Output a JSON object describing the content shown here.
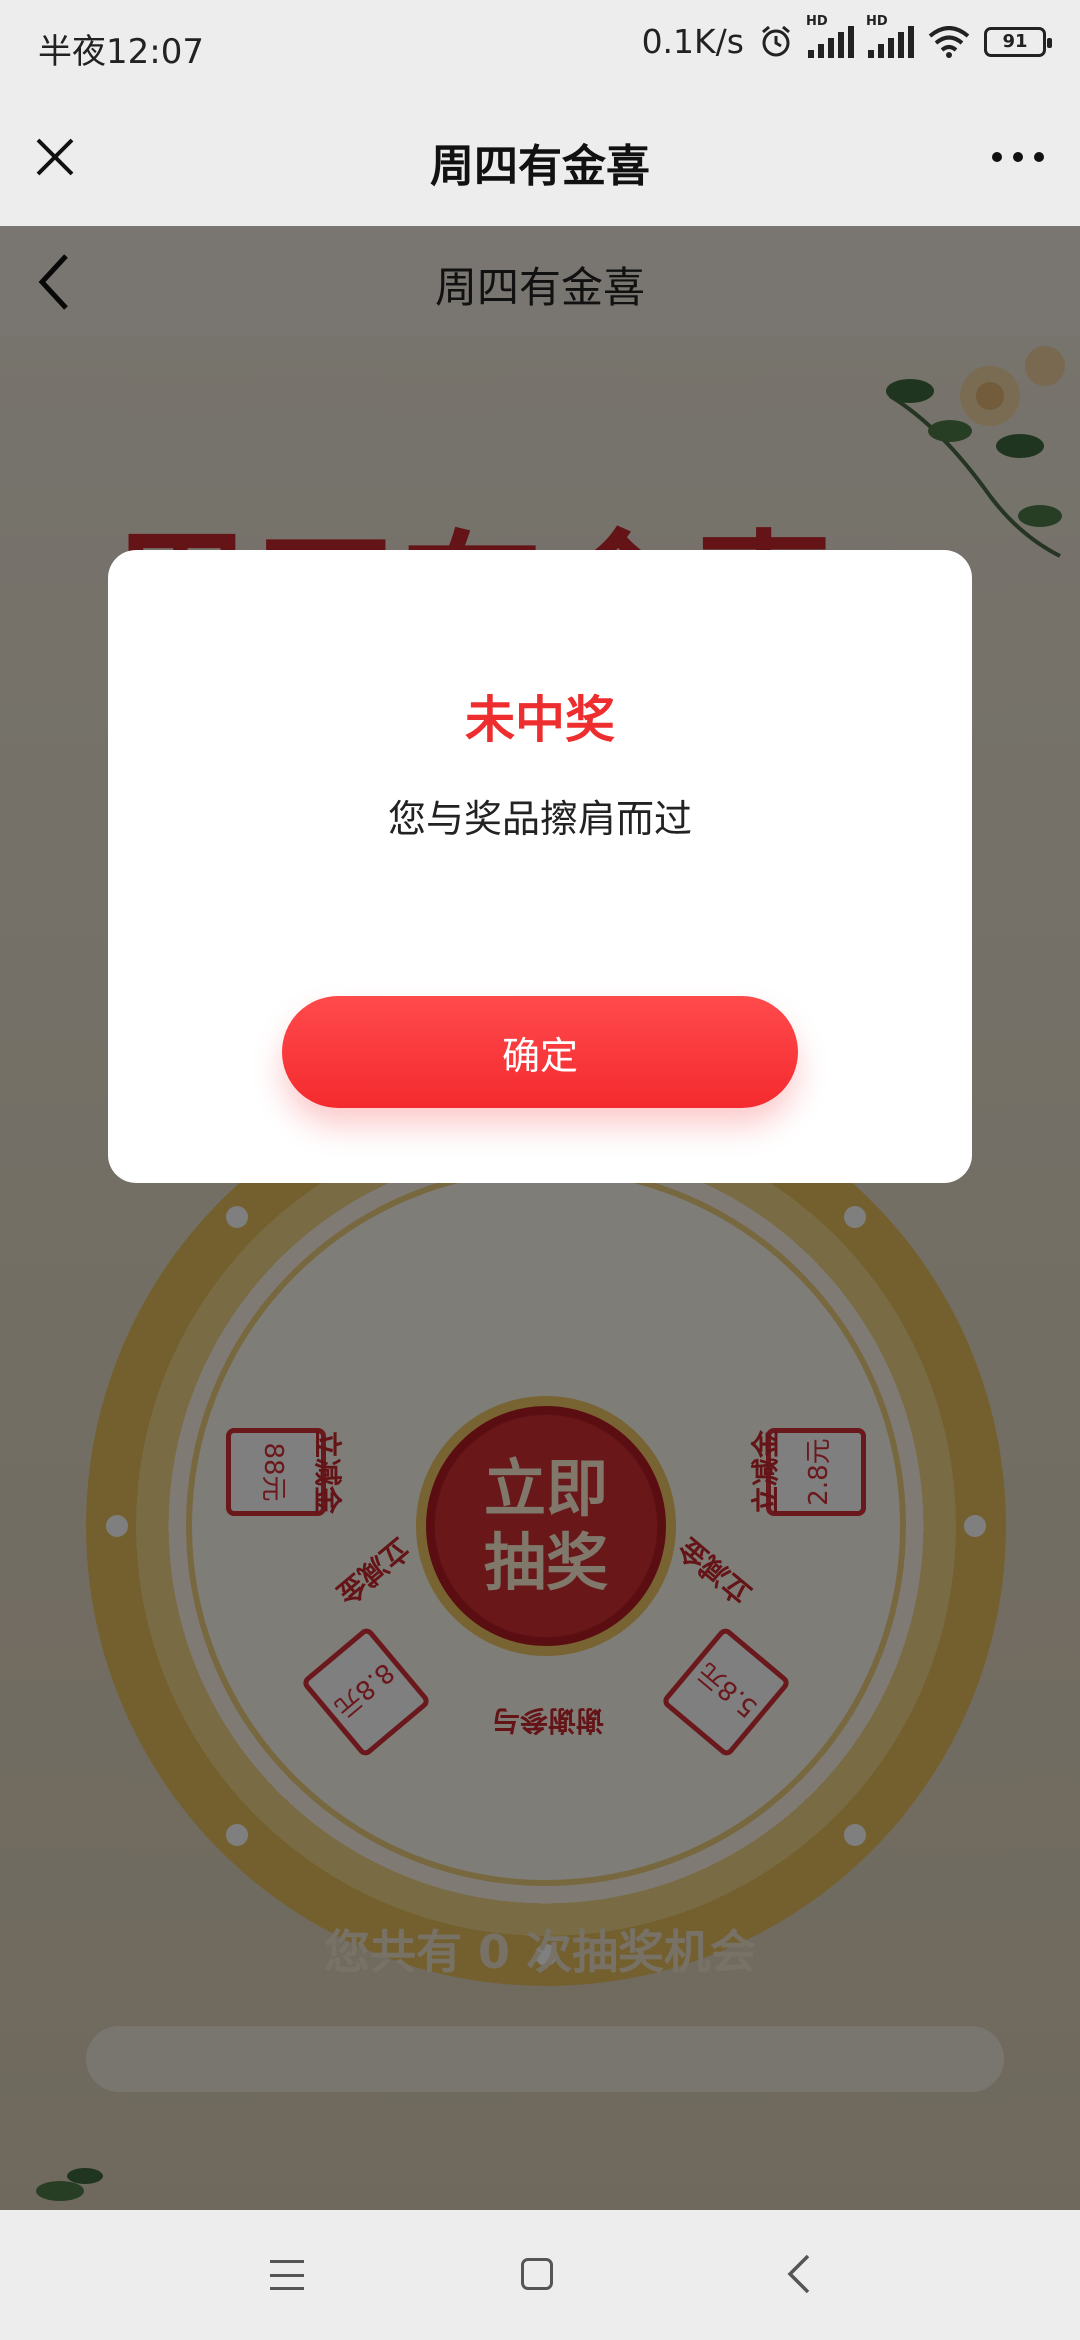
{
  "status_bar": {
    "time": "半夜12:07",
    "network_speed": "0.1K/s",
    "battery": "91",
    "hd1": "HD",
    "hd2": "HD"
  },
  "app_bar": {
    "title": "周四有金喜",
    "close_icon": "close-icon",
    "more_icon": "more-dots-icon"
  },
  "page": {
    "header_title": "周四有金喜",
    "big_title": "周四有金喜",
    "wheel": {
      "hub_line1": "立即",
      "hub_line2": "抽奖",
      "segments": [
        "立减金",
        "立减金",
        "谢谢参与",
        "立减金",
        "立减金"
      ],
      "coupons": [
        "88元",
        "2.8元",
        "8.8元",
        "5.8元"
      ]
    },
    "chances_text": "您共有 0 次抽奖机会"
  },
  "modal": {
    "title": "未中奖",
    "message": "您与奖品擦肩而过",
    "confirm_label": "确定"
  },
  "nav_bar": {
    "menu_icon": "menu-icon",
    "home_icon": "home-icon",
    "back_icon": "back-icon"
  }
}
